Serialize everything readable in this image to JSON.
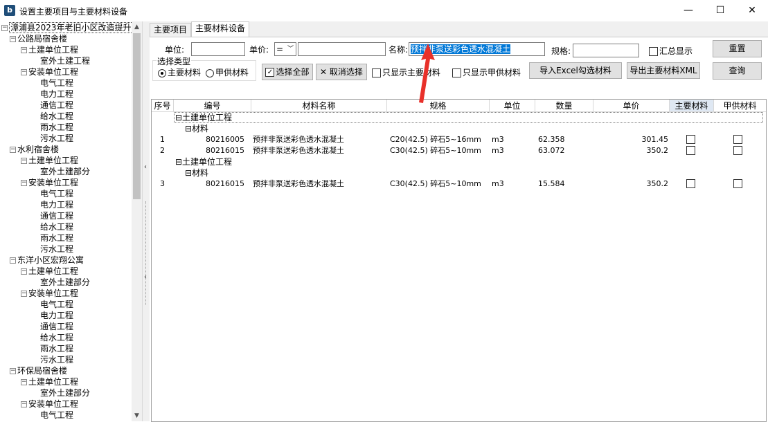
{
  "window": {
    "title": "设置主要项目与主要材料设备",
    "minimize": "—",
    "maximize": "☐",
    "close": "✕"
  },
  "tree": {
    "root": "漳浦县2023年老旧小区改造提升",
    "nodes": [
      {
        "level": 1,
        "label": "公路局宿舍楼",
        "toggle": "⊟"
      },
      {
        "level": 2,
        "label": "土建单位工程",
        "toggle": "⊟"
      },
      {
        "level": 3,
        "label": "室外土建工程"
      },
      {
        "level": 2,
        "label": "安装单位工程",
        "toggle": "⊟"
      },
      {
        "level": 3,
        "label": "电气工程"
      },
      {
        "level": 3,
        "label": "电力工程"
      },
      {
        "level": 3,
        "label": "通信工程"
      },
      {
        "level": 3,
        "label": "给水工程"
      },
      {
        "level": 3,
        "label": "雨水工程"
      },
      {
        "level": 3,
        "label": "污水工程"
      },
      {
        "level": 1,
        "label": "水利宿舍楼",
        "toggle": "⊟"
      },
      {
        "level": 2,
        "label": "土建单位工程",
        "toggle": "⊟"
      },
      {
        "level": 3,
        "label": "室外土建部分"
      },
      {
        "level": 2,
        "label": "安装单位工程",
        "toggle": "⊟"
      },
      {
        "level": 3,
        "label": "电气工程"
      },
      {
        "level": 3,
        "label": "电力工程"
      },
      {
        "level": 3,
        "label": "通信工程"
      },
      {
        "level": 3,
        "label": "给水工程"
      },
      {
        "level": 3,
        "label": "雨水工程"
      },
      {
        "level": 3,
        "label": "污水工程"
      },
      {
        "level": 1,
        "label": "东洋小区宏翔公寓",
        "toggle": "⊟"
      },
      {
        "level": 2,
        "label": "土建单位工程",
        "toggle": "⊟"
      },
      {
        "level": 3,
        "label": "室外土建部分"
      },
      {
        "level": 2,
        "label": "安装单位工程",
        "toggle": "⊟"
      },
      {
        "level": 3,
        "label": "电气工程"
      },
      {
        "level": 3,
        "label": "电力工程"
      },
      {
        "level": 3,
        "label": "通信工程"
      },
      {
        "level": 3,
        "label": "给水工程"
      },
      {
        "level": 3,
        "label": "雨水工程"
      },
      {
        "level": 3,
        "label": "污水工程"
      },
      {
        "level": 1,
        "label": "环保局宿舍楼",
        "toggle": "⊟"
      },
      {
        "level": 2,
        "label": "土建单位工程",
        "toggle": "⊟"
      },
      {
        "level": 3,
        "label": "室外土建部分"
      },
      {
        "level": 2,
        "label": "安装单位工程",
        "toggle": "⊟"
      },
      {
        "level": 3,
        "label": "电气工程"
      }
    ]
  },
  "tabs": [
    "主要项目",
    "主要材料设备"
  ],
  "filters": {
    "unit_label": "单位:",
    "unit_value": "",
    "price_label": "单价:",
    "price_op": "=",
    "price_value": "",
    "name_label": "名称:",
    "name_value": "预拌非泵送彩色透水混凝土",
    "spec_label": "规格:",
    "spec_value": "",
    "summary_label": "汇总显示",
    "reset_label": "重置",
    "query_label": "查询",
    "select_type_label": "选择类型",
    "radio_main": "主要材料",
    "radio_supply": "甲供材料",
    "select_all": "选择全部",
    "cancel_select": "取消选择",
    "only_main": "只显示主要材料",
    "only_supply": "只显示甲供材料",
    "import_excel": "导入Excel勾选材料",
    "export_xml": "导出主要材料XML"
  },
  "grid": {
    "columns": [
      "序号",
      "编号",
      "材料名称",
      "规格",
      "单位",
      "数量",
      "单价",
      "主要材料",
      "甲供材料"
    ],
    "groups": [
      {
        "title": "土建单位工程",
        "sub": "材料",
        "rows": [
          {
            "no": "1",
            "code": "80216005",
            "name": "预拌非泵送彩色透水混凝土",
            "spec": "C20(42.5) 碎石5~16mm",
            "unit": "m3",
            "qty": "62.358",
            "price": "301.45"
          },
          {
            "no": "2",
            "code": "80216015",
            "name": "预拌非泵送彩色透水混凝土",
            "spec": "C30(42.5) 碎石5~10mm",
            "unit": "m3",
            "qty": "63.072",
            "price": "350.2"
          }
        ]
      },
      {
        "title": "土建单位工程",
        "sub": "材料",
        "rows": [
          {
            "no": "3",
            "code": "80216015",
            "name": "预拌非泵送彩色透水混凝土",
            "spec": "C30(42.5) 碎石5~10mm",
            "unit": "m3",
            "qty": "15.584",
            "price": "350.2"
          }
        ]
      }
    ]
  },
  "colors": {
    "accent": "#0078d7",
    "arrow": "#e8302a"
  }
}
